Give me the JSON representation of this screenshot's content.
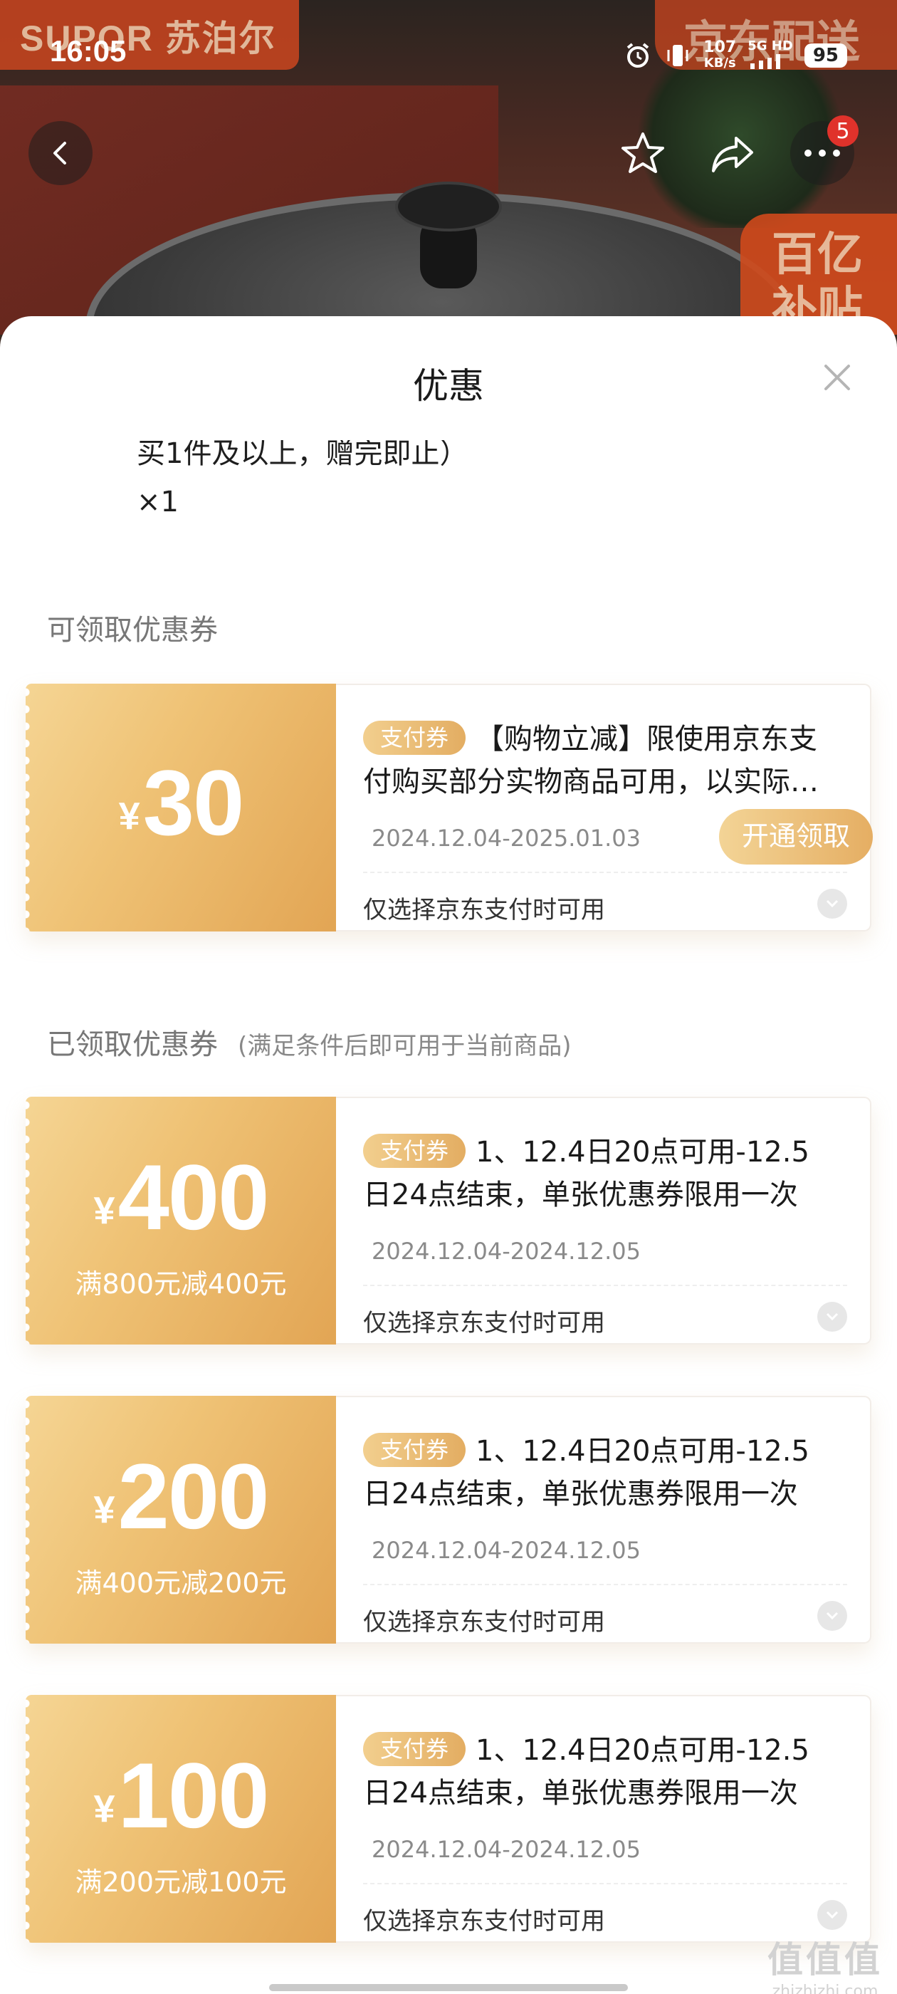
{
  "status_bar": {
    "time": "16:05",
    "net_speed_value": "107",
    "net_speed_unit": "KB/s",
    "network_tag_top": "5G HD",
    "network_tag_bottom": "",
    "battery": "95"
  },
  "hero": {
    "brand_logo": "SUPOR 苏泊尔",
    "delivery_tag": "京东配送",
    "subsidy_tag": "百亿补贴",
    "more_badge": "5"
  },
  "sheet": {
    "title": "优惠",
    "gift_text": "买1件及以上，赠完即止）",
    "gift_qty": "×1"
  },
  "available_section": {
    "title": "可领取优惠券",
    "coupons": [
      {
        "currency": "¥",
        "amount": "30",
        "condition": "",
        "tag": "支付券",
        "description": "【购物立减】限使用京东支付购买部分实物商品可用，以实际结算为准",
        "date_range": "2024.12.04-2025.01.03",
        "claim_label": "开通领取",
        "limit_text": "仅选择京东支付时可用"
      }
    ]
  },
  "claimed_section": {
    "title": "已领取优惠券",
    "note": "(满足条件后即可用于当前商品)",
    "coupons": [
      {
        "currency": "¥",
        "amount": "400",
        "condition": "满800元减400元",
        "tag": "支付券",
        "description": "1、12.4日20点可用-12.5日24点结束，单张优惠券限用一次",
        "date_range": "2024.12.04-2024.12.05",
        "limit_text": "仅选择京东支付时可用"
      },
      {
        "currency": "¥",
        "amount": "200",
        "condition": "满400元减200元",
        "tag": "支付券",
        "description": "1、12.4日20点可用-12.5日24点结束，单张优惠券限用一次",
        "date_range": "2024.12.04-2024.12.05",
        "limit_text": "仅选择京东支付时可用"
      },
      {
        "currency": "¥",
        "amount": "100",
        "condition": "满200元减100元",
        "tag": "支付券",
        "description": "1、12.4日20点可用-12.5日24点结束，单张优惠券限用一次",
        "date_range": "2024.12.04-2024.12.05",
        "limit_text": "仅选择京东支付时可用"
      }
    ]
  },
  "watermark": {
    "big": "值值值",
    "small": "zhizhizhi.com"
  },
  "icons": {
    "back": "chevron-left-icon",
    "favorite": "star-outline-icon",
    "share": "share-arrow-icon",
    "more": "more-dots-icon",
    "close": "close-x-icon",
    "expand": "chevron-down-icon",
    "alarm": "alarm-clock-icon",
    "vibrate": "vibrate-icon",
    "signal": "signal-bars-icon"
  },
  "colors": {
    "coupon_gold_light": "#f5d594",
    "coupon_gold_dark": "#e2a554",
    "badge_red": "#e0322b",
    "brand_orange": "#c3441f"
  }
}
